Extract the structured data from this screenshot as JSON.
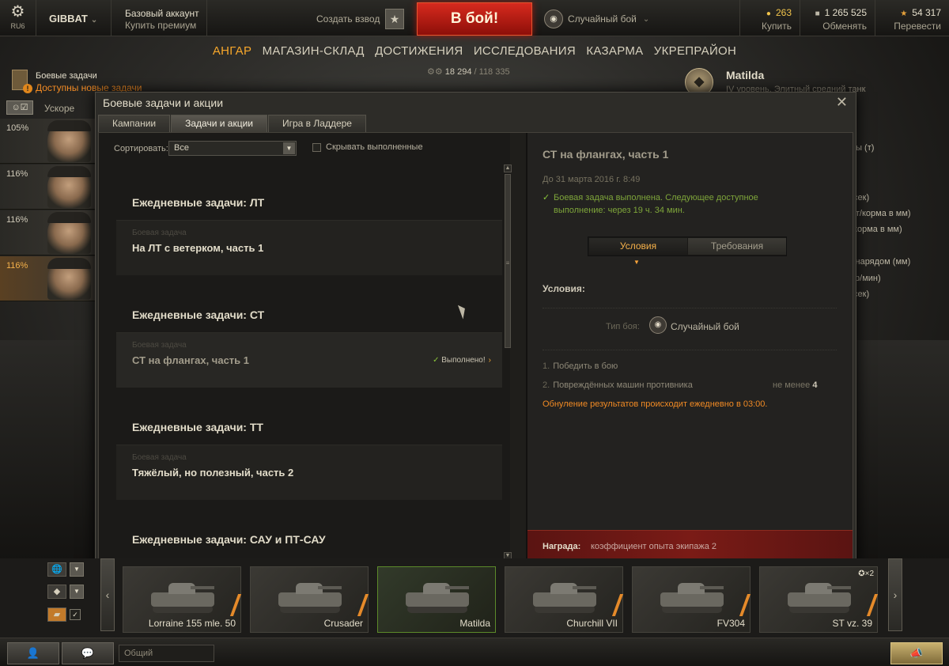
{
  "topbar": {
    "server": "RU6",
    "username": "GIBBAT",
    "account_type": "Базовый аккаунт",
    "buy_premium": "Купить премиум",
    "create_platoon": "Создать взвод",
    "battle_button": "В бой!",
    "battle_mode": "Случайный бой",
    "gold_value": "263",
    "gold_action": "Купить",
    "credits_value": "1 265 525",
    "credits_action": "Обменять",
    "free_xp_value": "54 317",
    "free_xp_action": "Перевести"
  },
  "mainnav": {
    "items": [
      "АНГАР",
      "МАГАЗИН-СКЛАД",
      "ДОСТИЖЕНИЯ",
      "ИССЛЕДОВАНИЯ",
      "КАЗАРМА",
      "УКРЕПРАЙОН"
    ]
  },
  "hangar": {
    "quests_title": "Боевые задачи",
    "quests_new": "Доступны новые задачи",
    "boost_label": "Ускоре",
    "xp_display": "18 294 / 118 335",
    "xp_current": "18 294",
    "xp_total": "118 335",
    "crew": [
      "105%",
      "116%",
      "116%",
      "116%"
    ],
    "tank_name": "Matilda",
    "tank_desc": "IV уровень. Элитный средний танк",
    "side_params": [
      "ны (т)",
      "/сек)",
      "рт/корма в мм)",
      "/корма в мм)",
      "снарядом (мм)",
      "тр/мин)",
      "/сек)"
    ]
  },
  "dialog": {
    "title": "Боевые задачи и акции",
    "tabs": [
      "Кампании",
      "Задачи и акции",
      "Игра в Ладдере"
    ],
    "sort_label": "Сортировать:",
    "sort_value": "Все",
    "hide_completed": "Скрывать выполненные",
    "groups": [
      {
        "title": "Ежедневные задачи: ЛТ",
        "sub": "Боевая задача",
        "quest": "На ЛТ с ветерком, часть 1",
        "done": false
      },
      {
        "title": "Ежедневные задачи: СТ",
        "sub": "Боевая задача",
        "quest": "СТ на флангах, часть 1",
        "done": true
      },
      {
        "title": "Ежедневные задачи: ТТ",
        "sub": "Боевая задача",
        "quest": "Тяжёлый, но полезный, часть 2",
        "done": false
      },
      {
        "title": "Ежедневные задачи: САУ и ПТ-САУ"
      }
    ],
    "done_label": "Выполнено!",
    "detail": {
      "title": "СТ на флангах, часть 1",
      "date": "До 31 марта 2016 г. 8:49",
      "status": "Боевая задача выполнена. Следующее доступное выполнение: через 19 ч. 34 мин.",
      "tab_conditions": "Условия",
      "tab_requirements": "Требования",
      "section_title": "Условия:",
      "battle_type_label": "Тип боя:",
      "battle_type_value": "Случайный бой",
      "conditions": [
        {
          "num": "1.",
          "text": "Победить в бою",
          "value_label": "",
          "value": ""
        },
        {
          "num": "2.",
          "text": "Повреждённых машин противника",
          "value_label": "не менее",
          "value": "4"
        }
      ],
      "reset_note": "Обнуление результатов происходит ежедневно в 03:00.",
      "reward_label": "Награда:",
      "reward_value": "коэффициент опыта экипажа 2"
    }
  },
  "carousel": {
    "tanks": [
      {
        "name": "Lorraine 155 mle. 50",
        "xp": ""
      },
      {
        "name": "Crusader",
        "xp": ""
      },
      {
        "name": "Matilda",
        "xp": ""
      },
      {
        "name": "Churchill VII",
        "xp": ""
      },
      {
        "name": "FV304",
        "xp": ""
      },
      {
        "name": "ST vz. 39",
        "xp": "✪×2"
      }
    ],
    "selected_index": 2
  },
  "bottombar": {
    "chat_channel": "Общий"
  },
  "colors": {
    "accent_orange": "#f7a72b",
    "battle_red": "#c8241a",
    "success_green": "#8ac53a",
    "warning_orange": "#f08a24"
  }
}
